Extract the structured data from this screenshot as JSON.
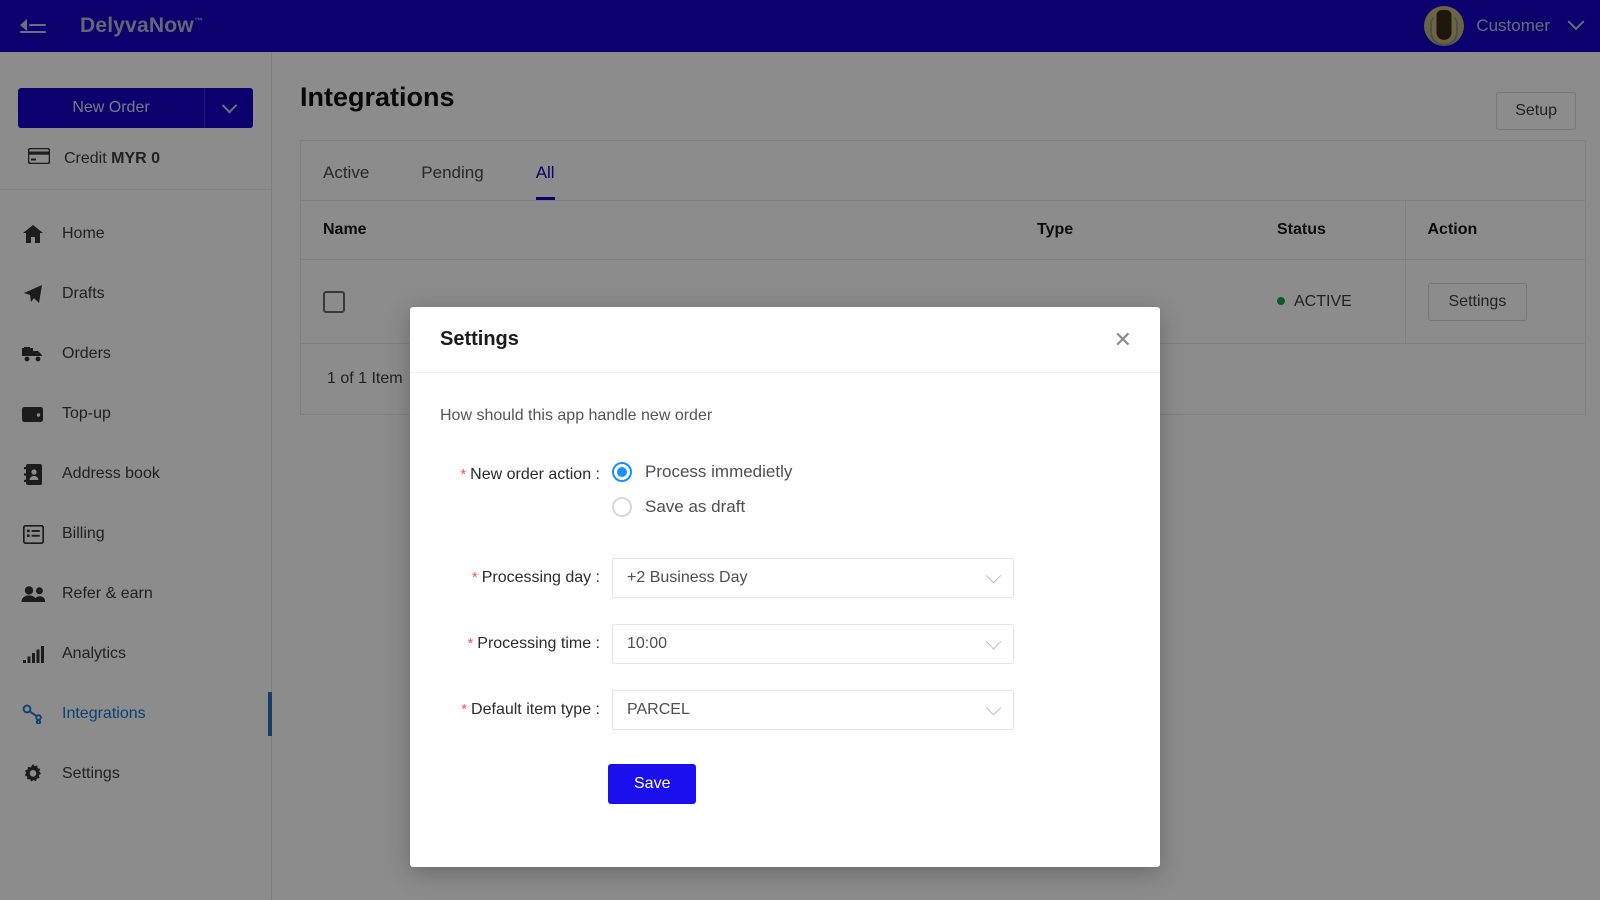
{
  "header": {
    "menu_icon": "menu-fold-icon",
    "brand": "DelyvaNow",
    "brand_mark": "™",
    "user_name": "Customer",
    "user_caret_icon": "chevron-down-icon",
    "bg_color": "#1400c8"
  },
  "sidebar": {
    "new_order_label": "New Order",
    "new_order_caret_icon": "chevron-down-icon",
    "credit_icon": "credit-card-icon",
    "credit_label": "Credit",
    "credit_value": "MYR 0",
    "items": [
      {
        "label": "Home",
        "icon": "home-icon",
        "active": false
      },
      {
        "label": "Drafts",
        "icon": "paper-plane-icon",
        "active": false
      },
      {
        "label": "Orders",
        "icon": "truck-icon",
        "active": false
      },
      {
        "label": "Top-up",
        "icon": "wallet-icon",
        "active": false
      },
      {
        "label": "Address book",
        "icon": "address-book-icon",
        "active": false
      },
      {
        "label": "Billing",
        "icon": "list-alt-icon",
        "active": false
      },
      {
        "label": "Refer & earn",
        "icon": "users-icon",
        "active": false
      },
      {
        "label": "Analytics",
        "icon": "bar-chart-icon",
        "active": false
      },
      {
        "label": "Integrations",
        "icon": "link-icon",
        "active": true
      },
      {
        "label": "Settings",
        "icon": "gear-icon",
        "active": false
      }
    ],
    "active_accent_color": "#2f6fbf"
  },
  "main": {
    "page_title": "Integrations",
    "setup_label": "Setup",
    "tabs": [
      {
        "label": "Active",
        "active": false
      },
      {
        "label": "Pending",
        "active": false
      },
      {
        "label": "All",
        "active": true
      }
    ],
    "table": {
      "columns": [
        "Name",
        "Type",
        "Status",
        "Action"
      ],
      "rows": [
        {
          "name": "",
          "name_icon": "app-logo-icon",
          "type": "",
          "status": "ACTIVE",
          "status_color": "#16a34a",
          "action_label": "Settings"
        }
      ]
    },
    "footer_count": "1 of 1 Item"
  },
  "modal": {
    "title": "Settings",
    "close_icon": "close-icon",
    "hint": "How should this app handle new order",
    "required_marker": "*",
    "fields": {
      "new_order_action": {
        "label": "New order action :",
        "options": [
          {
            "label": "Process immedietly",
            "selected": true
          },
          {
            "label": "Save as draft",
            "selected": false
          }
        ]
      },
      "processing_day": {
        "label": "Processing day :",
        "value": "+2 Business Day",
        "caret_icon": "chevron-down-icon"
      },
      "processing_time": {
        "label": "Processing time :",
        "value": "10:00",
        "caret_icon": "chevron-down-icon"
      },
      "default_item_type": {
        "label": "Default item type :",
        "value": "PARCEL",
        "caret_icon": "chevron-down-icon"
      }
    },
    "save_label": "Save",
    "save_color": "#1b10ed",
    "radio_accent": "#1890ff"
  }
}
